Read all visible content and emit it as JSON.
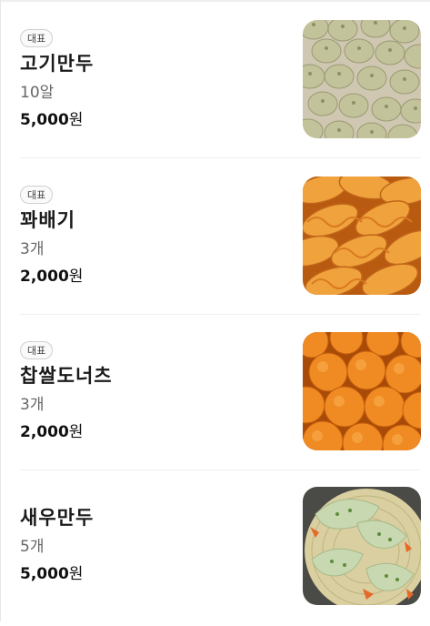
{
  "menu": {
    "items": [
      {
        "badge": "대표",
        "name": "고기만두",
        "desc": "10알",
        "price": "5,000",
        "price_unit": "원",
        "image": "dumplings-photo"
      },
      {
        "badge": "대표",
        "name": "꽈배기",
        "desc": "3개",
        "price": "2,000",
        "price_unit": "원",
        "image": "twisted-donut-photo"
      },
      {
        "badge": "대표",
        "name": "찹쌀도너츠",
        "desc": "3개",
        "price": "2,000",
        "price_unit": "원",
        "image": "rice-donut-photo"
      },
      {
        "name": "새우만두",
        "desc": "5개",
        "price": "5,000",
        "price_unit": "원",
        "image": "shrimp-dumpling-photo"
      }
    ]
  }
}
